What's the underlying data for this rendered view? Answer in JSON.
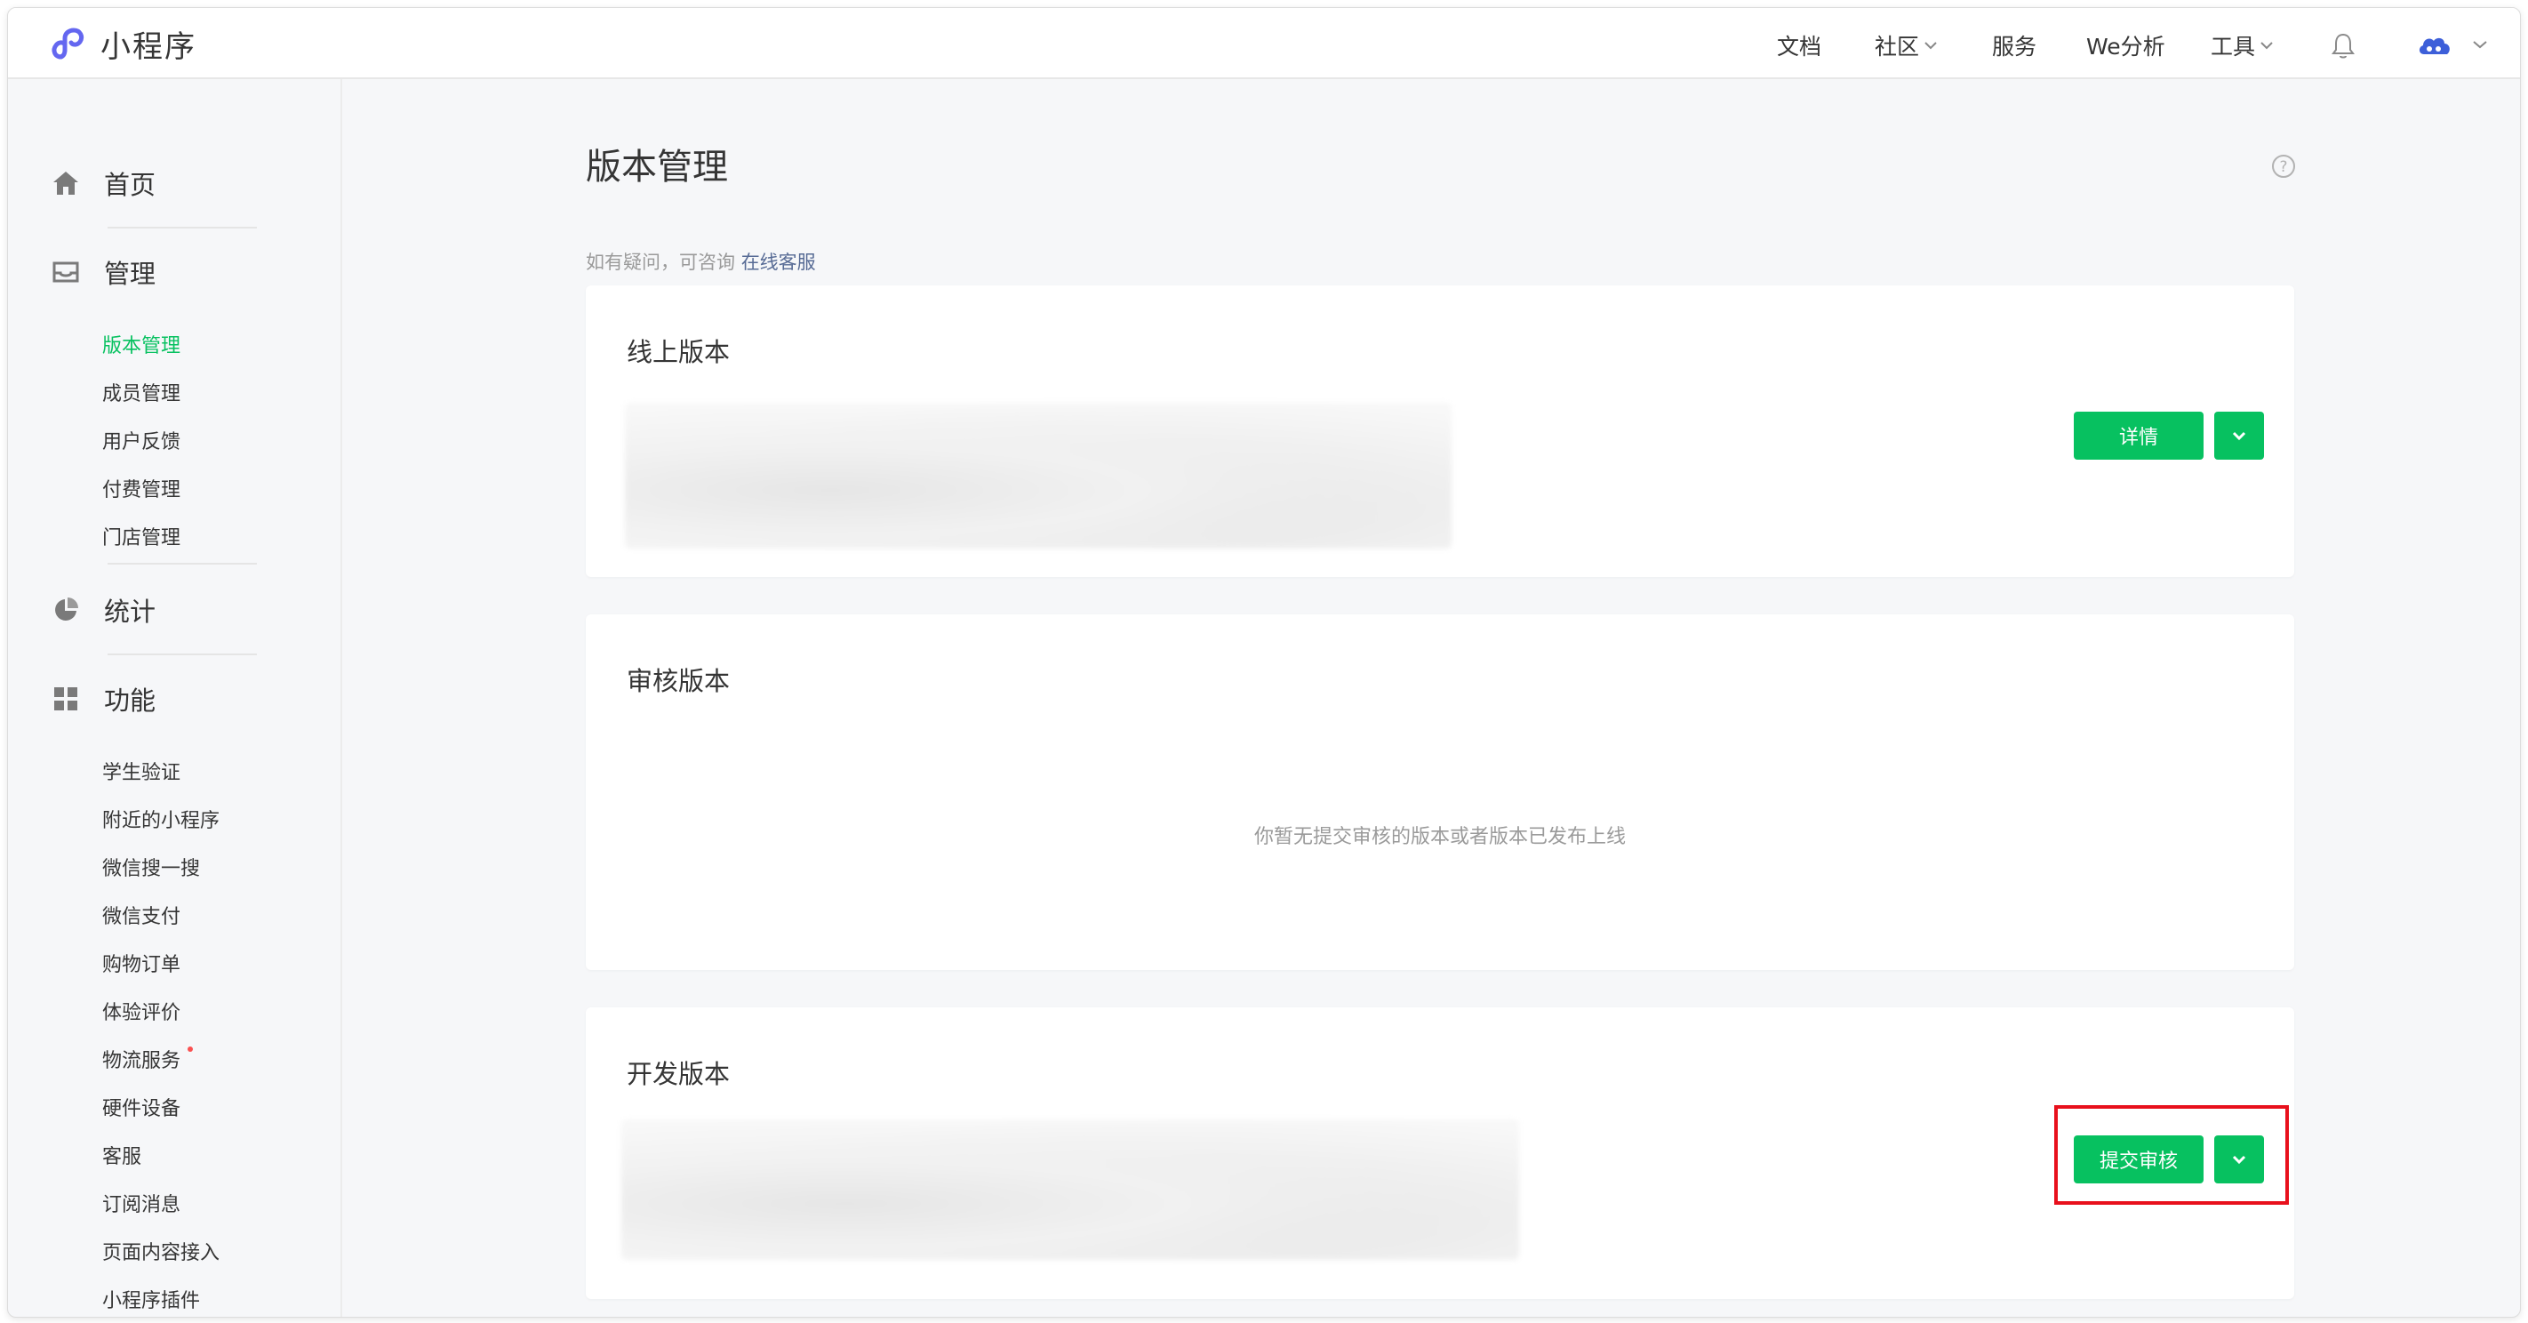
{
  "app": {
    "name": "小程序",
    "brand_color": "#07c160",
    "logo_color": "#6467f0"
  },
  "nav": {
    "items": [
      {
        "label": "文档"
      },
      {
        "label": "社区",
        "dropdown": true
      },
      {
        "label": "服务"
      },
      {
        "label": "We分析"
      },
      {
        "label": "工具",
        "dropdown": true
      }
    ],
    "bell_icon": "bell-icon",
    "avatar_icon": "cloud-avatar-icon"
  },
  "sidebar": {
    "home": "首页",
    "manage": {
      "label": "管理",
      "items": [
        "版本管理",
        "成员管理",
        "用户反馈",
        "付费管理",
        "门店管理"
      ],
      "active": "版本管理"
    },
    "stats": "统计",
    "features": {
      "label": "功能",
      "items": [
        "学生验证",
        "附近的小程序",
        "微信搜一搜",
        "微信支付",
        "购物订单",
        "体验评价",
        "物流服务",
        "硬件设备",
        "客服",
        "订阅消息",
        "页面内容接入",
        "小程序插件"
      ],
      "badge_item": "物流服务"
    }
  },
  "main": {
    "title": "版本管理",
    "hint_prefix": "如有疑问，可咨询 ",
    "hint_link": "在线客服",
    "online": {
      "title": "线上版本",
      "button": "详情"
    },
    "review": {
      "title": "审核版本",
      "empty": "你暂无提交审核的版本或者版本已发布上线"
    },
    "dev": {
      "title": "开发版本",
      "button": "提交审核"
    }
  }
}
